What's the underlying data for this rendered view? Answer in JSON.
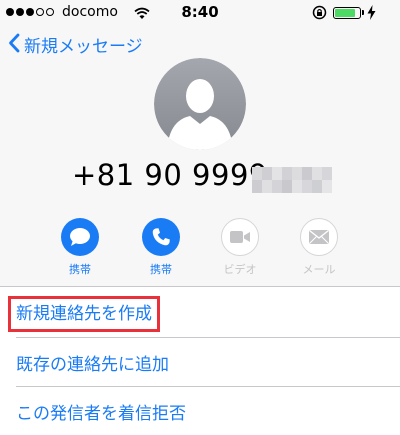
{
  "status_bar": {
    "carrier": "docomo",
    "time": "8:40",
    "signal_bars_filled": 3,
    "signal_bars_total": 5,
    "battery_level": 0.85,
    "battery_color": "#4cd964"
  },
  "nav": {
    "back_label": "新規メッセージ",
    "accent_color": "#1a7cf5"
  },
  "contact": {
    "phone_number": "+81 90 9999",
    "avatar_icon": "person-silhouette-icon"
  },
  "actions": [
    {
      "label": "携帯",
      "icon": "message-bubble-icon",
      "enabled": true
    },
    {
      "label": "携帯",
      "icon": "phone-icon",
      "enabled": true
    },
    {
      "label": "ビデオ",
      "icon": "video-camera-icon",
      "enabled": false
    },
    {
      "label": "メール",
      "icon": "mail-icon",
      "enabled": false
    }
  ],
  "list": {
    "items": [
      {
        "label": "新規連絡先を作成",
        "highlighted": true
      },
      {
        "label": "既存の連絡先に追加"
      },
      {
        "label": "この発信者を着信拒否"
      }
    ],
    "highlight_color": "#e8313a"
  }
}
